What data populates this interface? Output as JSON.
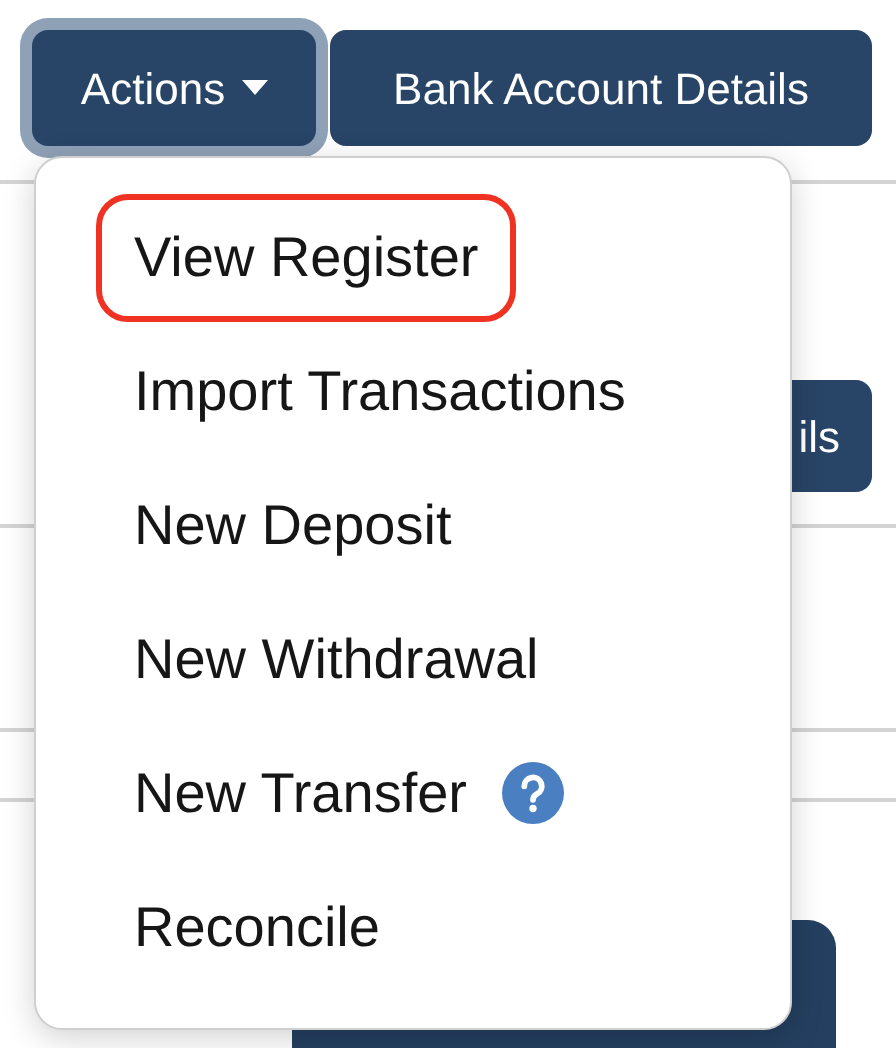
{
  "toolbar": {
    "actions_button": {
      "label": "Actions",
      "expanded": true
    },
    "bank_details_button": {
      "label": "Bank Account Details"
    }
  },
  "background_button": {
    "label": "ils"
  },
  "actions_menu": {
    "items": [
      {
        "label": "View Register",
        "highlighted": true,
        "help": false
      },
      {
        "label": "Import Transactions",
        "highlighted": false,
        "help": false
      },
      {
        "label": "New Deposit",
        "highlighted": false,
        "help": false
      },
      {
        "label": "New Withdrawal",
        "highlighted": false,
        "help": false
      },
      {
        "label": "New Transfer",
        "highlighted": false,
        "help": true
      },
      {
        "label": "Reconcile",
        "highlighted": false,
        "help": false
      }
    ]
  }
}
